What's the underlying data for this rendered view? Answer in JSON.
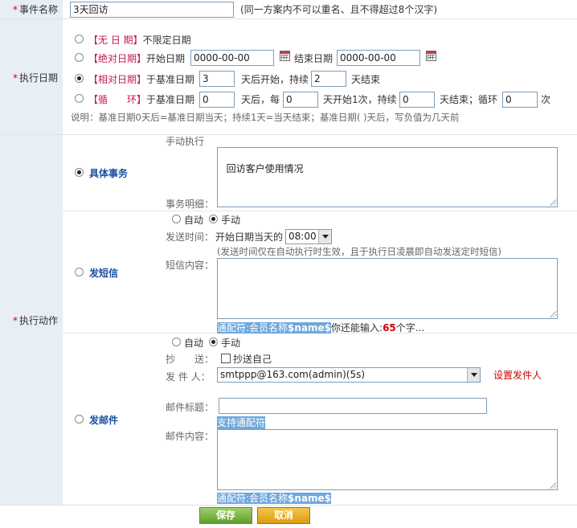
{
  "event_name": {
    "label": "事件名称",
    "value": "3天回访",
    "hint": "(同一方案内不可以重名、且不得超过8个汉字)"
  },
  "exec_date": {
    "label": "执行日期",
    "none": {
      "bracket": "【无 日 期】",
      "text": "不限定日期"
    },
    "absolute": {
      "bracket": "【绝对日期】",
      "start_label": "开始日期",
      "start_value": "0000-00-00",
      "end_label": "结束日期",
      "end_value": "0000-00-00"
    },
    "relative": {
      "bracket": "【相对日期】",
      "prefix": "于基准日期",
      "start": "3",
      "mid": "天后开始，持续",
      "duration": "2",
      "suffix": "天结束"
    },
    "cycle": {
      "bracket": "【循　　环】",
      "prefix": "于基准日期",
      "v1": "0",
      "t1": "天后，每",
      "v2": "0",
      "t2": "天开始1次，持续",
      "v3": "0",
      "t3": "天结束；循环",
      "v4": "0",
      "t4": "次"
    },
    "note": "说明：基准日期0天后=基准日期当天；持续1天=当天结束；基准日期(  )天后，写负值为几天前"
  },
  "exec_action": {
    "label": "执行动作",
    "task": {
      "title": "具体事务",
      "manual": "手动执行",
      "detail_label": "事务明细：",
      "detail_value": "回访客户使用情况"
    },
    "sms": {
      "title": "发短信",
      "auto": "自动",
      "manual": "手动",
      "send_time_label": "发送时间：",
      "send_time_prefix": "开始日期当天的",
      "send_time_value": "08:00",
      "send_time_note": "(发送时间仅在自动执行时生效，且于执行日凌晨即自动发送定时短信)",
      "content_label": "短信内容：",
      "wildcard_prefix": "通配符:会员名称",
      "wildcard_var": "$name$",
      "remain_prefix": "你还能输入:",
      "remain_count": "65",
      "remain_suffix": "个字..."
    },
    "email": {
      "title": "发邮件",
      "auto": "自动",
      "manual": "手动",
      "cc_label": "抄　　送：",
      "cc_text": "抄送自己",
      "sender_label": "发 件 人：",
      "sender_value": "smtppp@163.com(admin)(5s)",
      "sender_link": "设置发件人",
      "subject_label": "邮件标题：",
      "subject_hint": "支持通配符",
      "content_label": "邮件内容：",
      "wildcard_prefix": "通配符:会员名称",
      "wildcard_var": "$name$"
    }
  },
  "buttons": {
    "save": "保存",
    "cancel": "取消"
  }
}
